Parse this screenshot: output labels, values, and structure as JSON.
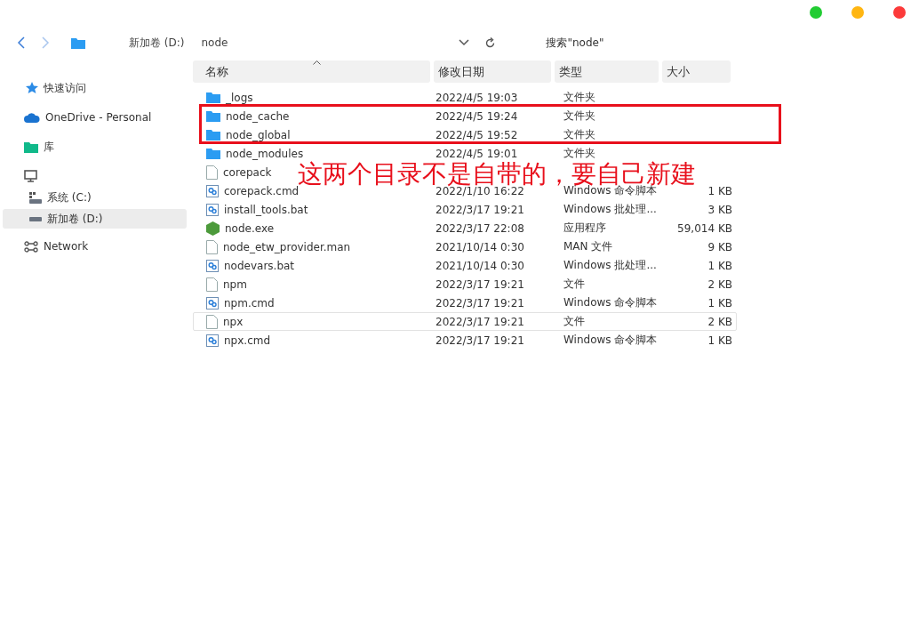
{
  "window": {
    "controls": [
      {
        "color": "#22cc33"
      },
      {
        "color": "#ffb612"
      },
      {
        "color": "#fc3a3a"
      }
    ]
  },
  "toolbar": {
    "breadcrumbs": [
      "新加卷 (D:)",
      "node"
    ],
    "search": {
      "placeholder": "搜索\"node\""
    }
  },
  "sidebar": {
    "items": [
      {
        "label": "快速访问",
        "selected": false
      },
      {
        "label": "OneDrive - Personal",
        "selected": false
      },
      {
        "label": "库",
        "selected": false
      },
      {
        "selected": false,
        "children": [
          {
            "label": "系统 (C:)",
            "selected": false
          },
          {
            "label": "新加卷 (D:)",
            "selected": true
          }
        ]
      },
      {
        "label": "Network",
        "selected": false
      }
    ]
  },
  "table": {
    "columns": [
      "名称",
      "修改日期",
      "类型",
      "大小"
    ],
    "rows": [
      {
        "name": "_logs",
        "kind": "folder",
        "date": "2022/4/5 19:03",
        "type": "文件夹",
        "boxed": false,
        "focused": false
      },
      {
        "name": "node_cache",
        "kind": "folder",
        "date": "2022/4/5 19:24",
        "type": "文件夹",
        "boxed": true,
        "focused": false
      },
      {
        "name": "node_global",
        "kind": "folder",
        "date": "2022/4/5 19:52",
        "type": "文件夹",
        "boxed": true,
        "focused": false
      },
      {
        "name": "node_modules",
        "kind": "folder",
        "date": "2022/4/5 19:01",
        "type": "文件夹",
        "boxed": false,
        "focused": false
      },
      {
        "name": "corepack",
        "kind": "file",
        "boxed": false,
        "focused": false
      },
      {
        "name": "corepack.cmd",
        "kind": "script",
        "date": "2022/1/10 16:22",
        "type": "Windows 命令脚本",
        "size": "1 KB",
        "boxed": false,
        "focused": false
      },
      {
        "name": "install_tools.bat",
        "kind": "script",
        "date": "2022/3/17 19:21",
        "type": "Windows 批处理...",
        "size": "3 KB",
        "boxed": false,
        "focused": false
      },
      {
        "name": "node.exe",
        "kind": "exe",
        "date": "2022/3/17 22:08",
        "type": "应用程序",
        "size": "59,014 KB",
        "boxed": false,
        "focused": false
      },
      {
        "name": "node_etw_provider.man",
        "kind": "file",
        "date": "2021/10/14 0:30",
        "type": "MAN 文件",
        "size": "9 KB",
        "boxed": false,
        "focused": false
      },
      {
        "name": "nodevars.bat",
        "kind": "script",
        "date": "2021/10/14 0:30",
        "type": "Windows 批处理...",
        "size": "1 KB",
        "boxed": false,
        "focused": false
      },
      {
        "name": "npm",
        "kind": "file",
        "date": "2022/3/17 19:21",
        "type": "文件",
        "size": "2 KB",
        "boxed": false,
        "focused": false
      },
      {
        "name": "npm.cmd",
        "kind": "script",
        "date": "2022/3/17 19:21",
        "type": "Windows 命令脚本",
        "size": "1 KB",
        "boxed": false,
        "focused": false
      },
      {
        "name": "npx",
        "kind": "file",
        "date": "2022/3/17 19:21",
        "type": "文件",
        "size": "2 KB",
        "boxed": false,
        "focused": true
      },
      {
        "name": "npx.cmd",
        "kind": "script",
        "date": "2022/3/17 19:21",
        "type": "Windows 命令脚本",
        "size": "1 KB",
        "boxed": false,
        "focused": false
      }
    ]
  },
  "annotation": {
    "text": "这两个目录不是自带的，要自己新建",
    "color": "#e8101c"
  }
}
